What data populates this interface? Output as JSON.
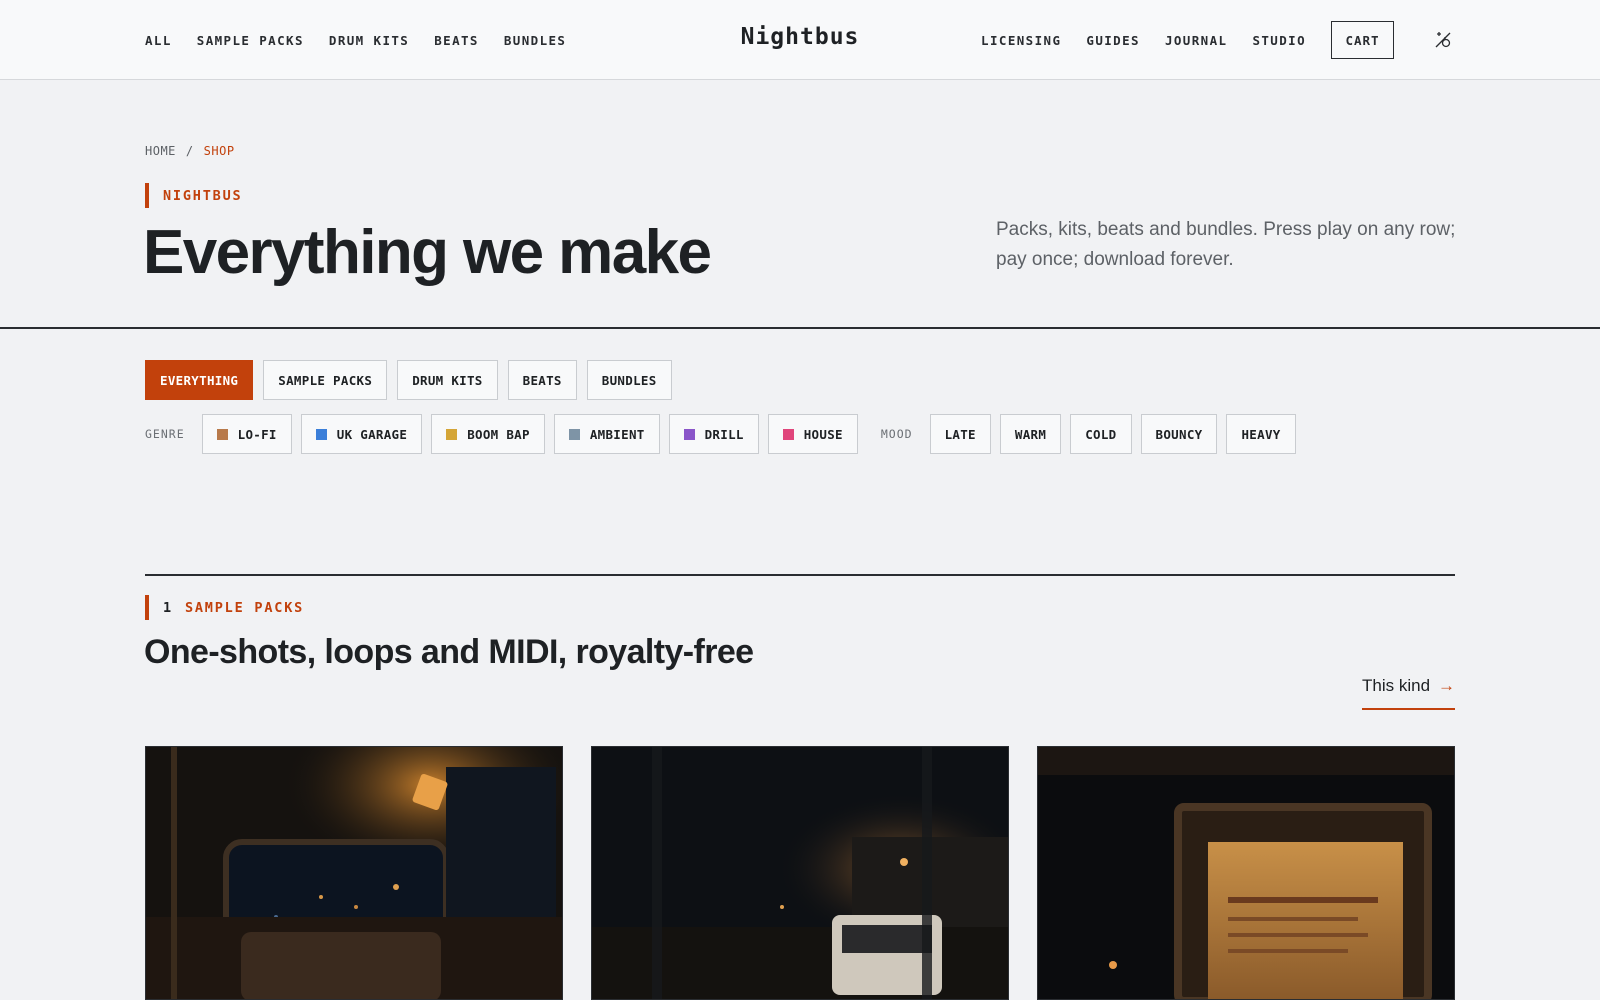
{
  "header": {
    "nav_left": [
      "ALL",
      "SAMPLE PACKS",
      "DRUM KITS",
      "BEATS",
      "BUNDLES"
    ],
    "logo": "Nightbus",
    "nav_right": [
      "LICENSING",
      "GUIDES",
      "JOURNAL",
      "STUDIO"
    ],
    "cart_label": "CART",
    "theme_icon": "theme-toggle-icon"
  },
  "breadcrumb": {
    "home": "HOME",
    "separator": "/",
    "current": "SHOP"
  },
  "hero": {
    "eyebrow": "NIGHTBUS",
    "title": "Everything we make",
    "description": "Packs, kits, beats and bundles. Press play on any row; pay once; download forever."
  },
  "type_tabs": [
    {
      "label": "EVERYTHING",
      "active": true
    },
    {
      "label": "SAMPLE PACKS",
      "active": false
    },
    {
      "label": "DRUM KITS",
      "active": false
    },
    {
      "label": "BEATS",
      "active": false
    },
    {
      "label": "BUNDLES",
      "active": false
    }
  ],
  "genre": {
    "label": "GENRE",
    "items": [
      {
        "label": "LO-FI",
        "color": "#b87a4b"
      },
      {
        "label": "UK GARAGE",
        "color": "#3b7fd9"
      },
      {
        "label": "BOOM BAP",
        "color": "#d4a537"
      },
      {
        "label": "AMBIENT",
        "color": "#7e94a6"
      },
      {
        "label": "DRILL",
        "color": "#8a55c9"
      },
      {
        "label": "HOUSE",
        "color": "#e0457b"
      }
    ]
  },
  "mood": {
    "label": "MOOD",
    "items": [
      "LATE",
      "WARM",
      "COLD",
      "BOUNCY",
      "HEAVY"
    ]
  },
  "section": {
    "number": "1",
    "eyebrow": "SAMPLE PACKS",
    "title": "One-shots, loops and MIDI, royalty-free",
    "link_label": "This kind",
    "link_arrow": "→"
  },
  "colors": {
    "accent": "#c2410c",
    "text": "#1e2124",
    "background": "#f1f2f4"
  }
}
